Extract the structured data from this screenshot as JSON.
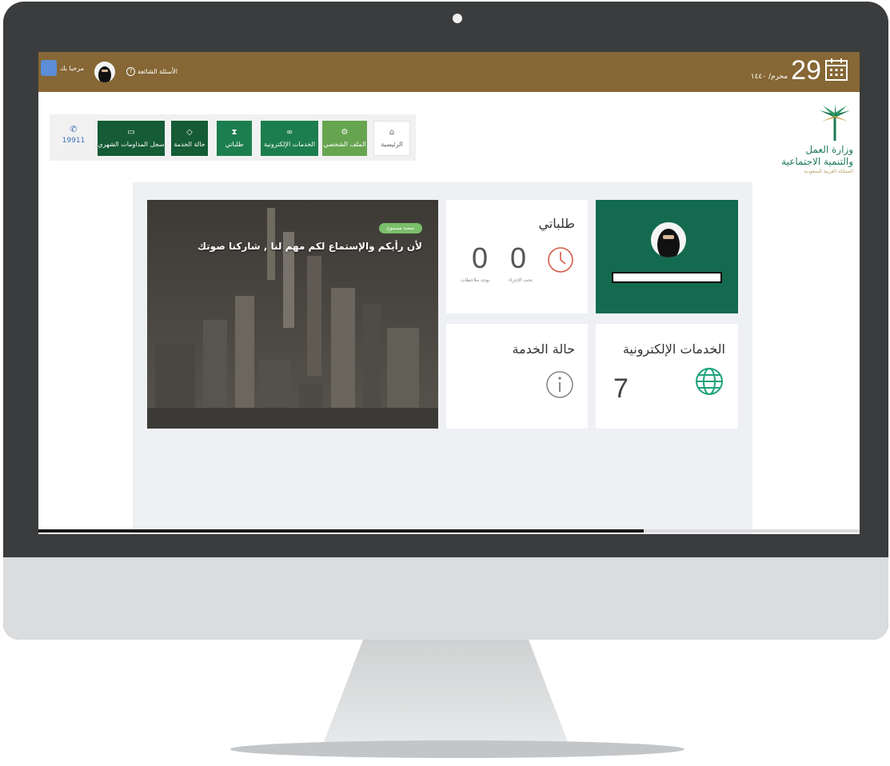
{
  "topbar": {
    "welcome": "مرحبا بك",
    "faq": "الأسئلة الشائعة",
    "date_day": "29",
    "date_month": "محرم/ ١٤٤٠"
  },
  "nav": {
    "phone": "19911",
    "items": [
      {
        "label": "سجل المداومات الشهري",
        "icon": "card-icon"
      },
      {
        "label": "حالة الخدمة",
        "icon": "tag-icon"
      },
      {
        "label": "طلباتي",
        "icon": "hourglass-icon"
      },
      {
        "label": "الخدمات الإلكترونية",
        "icon": "link-icon"
      },
      {
        "label": "الملف الشخصي",
        "icon": "gear-icon"
      },
      {
        "label": "الرئيسية",
        "icon": "home-icon"
      }
    ]
  },
  "logo": {
    "line1": "وزارة العمل",
    "line2": "والتنمية الاجتماعية",
    "line3": "المملكة العربية السعودية"
  },
  "banner": {
    "tag": "منصة مسموع",
    "text": "لأن رأيكم والإستماع لكم مهم لنا , شاركنا صوتك"
  },
  "requests_card": {
    "title": "طلباتي",
    "in_progress_count": "0",
    "in_progress_label": "تحت الإجراء",
    "notes_count": "0",
    "notes_label": "يوجد ملاحظات"
  },
  "eservices_card": {
    "title": "الخدمات الإلكترونية",
    "count": "7"
  },
  "status_card": {
    "title": "حالة الخدمة"
  },
  "colors": {
    "topbar": "#866735",
    "profile_bg": "#146a4f",
    "nav_dark": "#155b35",
    "nav_mid": "#1c7e4e",
    "nav_light": "#67a450",
    "accent_green": "#1ea27a",
    "clock_red": "#d25c48"
  }
}
